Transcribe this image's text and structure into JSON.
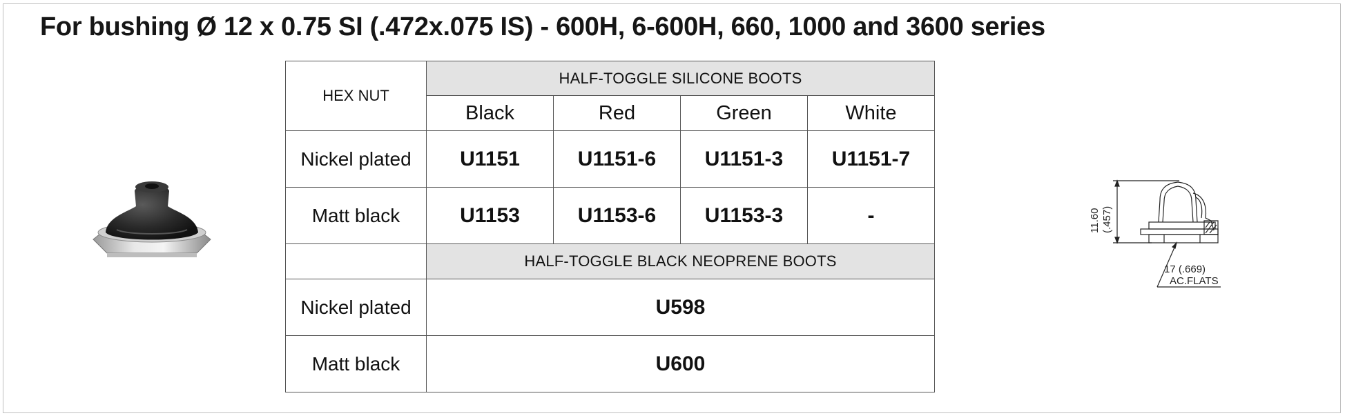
{
  "title": "For bushing Ø 12 x 0.75 SI (.472x.075 IS) - 600H, 6-600H, 660, 1000 and 3600 series",
  "table": {
    "hex_nut_header": "HEX NUT",
    "silicone_group_header": "HALF-TOGGLE SILICONE BOOTS",
    "colors": [
      "Black",
      "Red",
      "Green",
      "White"
    ],
    "silicone_rows": [
      {
        "finish": "Nickel plated",
        "codes": [
          "U1151",
          "U1151-6",
          "U1151-3",
          "U1151-7"
        ]
      },
      {
        "finish": "Matt black",
        "codes": [
          "U1153",
          "U1153-6",
          "U1153-3",
          "-"
        ]
      }
    ],
    "neoprene_group_header": "HALF-TOGGLE BLACK NEOPRENE BOOTS",
    "neoprene_rows": [
      {
        "finish": "Nickel plated",
        "code": "U598"
      },
      {
        "finish": "Matt black",
        "code": "U600"
      }
    ]
  },
  "drawing": {
    "height_mm": "11.60",
    "height_in": "(.457)",
    "flats_dim": "17 (.669)",
    "flats_label": "AC.FLATS"
  }
}
